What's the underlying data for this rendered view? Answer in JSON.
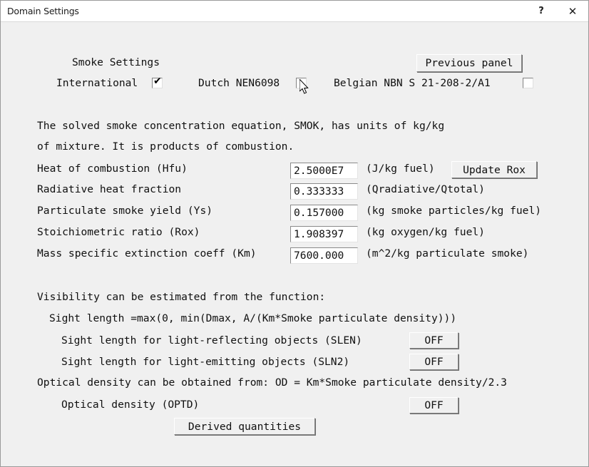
{
  "window": {
    "title": "Domain Settings",
    "help_label": "?",
    "close_label": "✕",
    "background_color": "#f0f0f0",
    "titlebar_color": "#ffffff"
  },
  "panel": {
    "heading": "Smoke Settings",
    "previous_panel_button": "Previous panel"
  },
  "standards": [
    {
      "label": "International",
      "checked": true,
      "tick": "✔"
    },
    {
      "label": "Dutch NEN6098",
      "checked": false,
      "tick": ""
    },
    {
      "label": "Belgian NBN S 21-208-2/A1",
      "checked": false,
      "tick": ""
    }
  ],
  "description": {
    "line1": "The solved smoke concentration equation, SMOK, has units of kg/kg",
    "line2": "of mixture. It is products of combustion."
  },
  "parameters": [
    {
      "label": "Heat of combustion (Hfu)",
      "value": "2.5000E7",
      "units": "(J/kg fuel)"
    },
    {
      "label": "Radiative heat fraction",
      "value": "0.333333",
      "units": "(Qradiative/Qtotal)"
    },
    {
      "label": "Particulate smoke yield (Ys)",
      "value": "0.157000",
      "units": "(kg smoke particles/kg fuel)"
    },
    {
      "label": "Stoichiometric ratio (Rox)",
      "value": "1.908397",
      "units": "(kg oxygen/kg fuel)"
    },
    {
      "label": "Mass specific extinction coeff (Km)",
      "value": "7600.000",
      "units": "(m^2/kg particulate smoke)"
    }
  ],
  "update_rox_button": "Update Rox",
  "visibility": {
    "intro": "Visibility can be estimated from the function:",
    "formula": "Sight length =max(0, min(Dmax, A/(Km*Smoke particulate density)))",
    "optical_density_note": "Optical density can be obtained from: OD = Km*Smoke particulate density/2.3"
  },
  "toggles": [
    {
      "label": "Sight length for light-reflecting objects (SLEN)",
      "state": "OFF"
    },
    {
      "label": "Sight length for light-emitting objects (SLN2)",
      "state": "OFF"
    },
    {
      "label": "Optical density (OPTD)",
      "state": "OFF"
    }
  ],
  "derived_quantities_button": "Derived quantities"
}
